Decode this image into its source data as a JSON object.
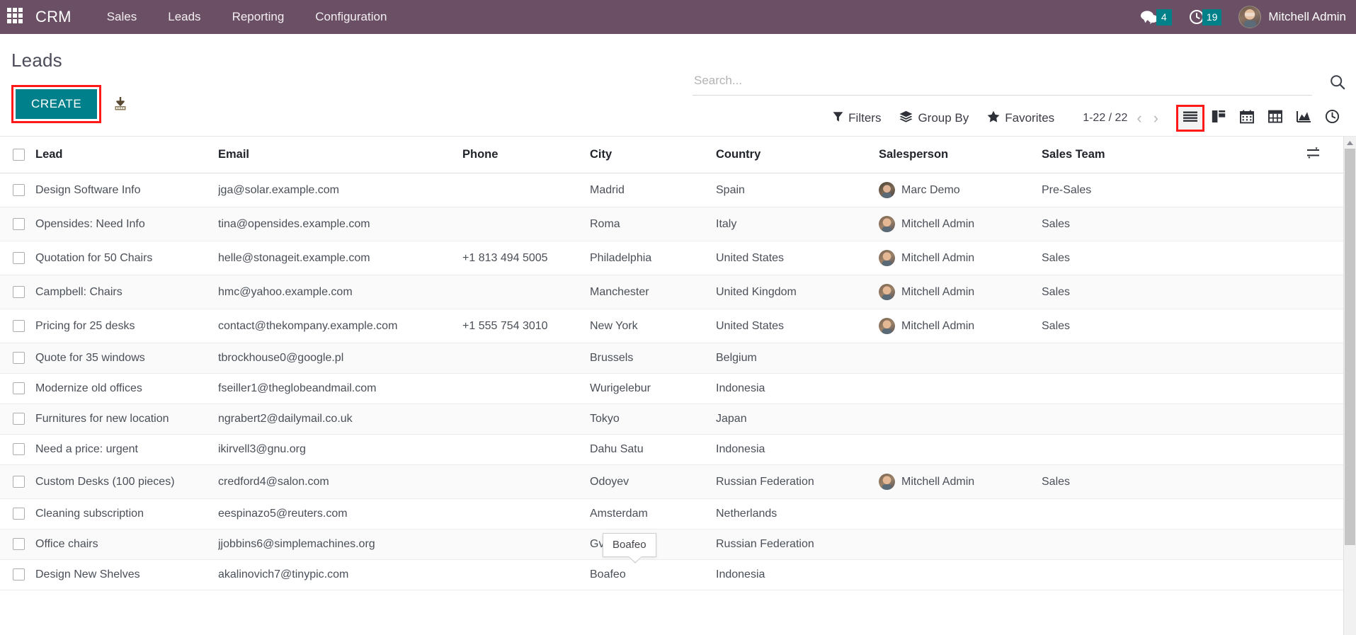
{
  "navbar": {
    "apps_icon": "apps-grid-icon",
    "brand": "CRM",
    "menu": [
      {
        "label": "Sales"
      },
      {
        "label": "Leads"
      },
      {
        "label": "Reporting"
      },
      {
        "label": "Configuration"
      }
    ],
    "messages": {
      "icon": "comments-icon",
      "count": "4"
    },
    "activities": {
      "icon": "clock-icon",
      "count": "19"
    },
    "user": {
      "name": "Mitchell Admin",
      "avatar": "user-avatar"
    }
  },
  "control_panel": {
    "title": "Leads",
    "create_label": "CREATE",
    "import_icon": "import-download-icon",
    "highlight_color": "#ff1a1a",
    "create_color": "#00808b",
    "search": {
      "placeholder": "Search...",
      "value": ""
    },
    "search_icon": "search-magnifier-icon",
    "dropdowns": [
      {
        "label": "Filters",
        "icon": "filter-funnel-icon"
      },
      {
        "label": "Group By",
        "icon": "layers-icon"
      },
      {
        "label": "Favorites",
        "icon": "star-icon"
      }
    ],
    "pager": {
      "count": "1-22 / 22",
      "prev": "‹",
      "next": "›"
    },
    "views": [
      {
        "name": "list-view",
        "icon": "list-icon",
        "active": true
      },
      {
        "name": "kanban-view",
        "icon": "kanban-icon",
        "active": false
      },
      {
        "name": "calendar-view",
        "icon": "calendar-icon",
        "active": false
      },
      {
        "name": "pivot-view",
        "icon": "pivot-table-icon",
        "active": false
      },
      {
        "name": "graph-view",
        "icon": "area-chart-icon",
        "active": false
      },
      {
        "name": "activity-view",
        "icon": "clock-icon",
        "active": false
      }
    ]
  },
  "table": {
    "select_all_checkbox": "",
    "options_icon": "column-options-icon",
    "headers": {
      "lead": "Lead",
      "email": "Email",
      "phone": "Phone",
      "city": "City",
      "country": "Country",
      "salesperson": "Salesperson",
      "sales_team": "Sales Team"
    },
    "rows": [
      {
        "lead": "Design Software Info",
        "email": "jga@solar.example.com",
        "phone": "",
        "city": "Madrid",
        "country": "Spain",
        "salesperson": "Marc Demo",
        "team": "Pre-Sales"
      },
      {
        "lead": "Opensides: Need Info",
        "email": "tina@opensides.example.com",
        "phone": "",
        "city": "Roma",
        "country": "Italy",
        "salesperson": "Mitchell Admin",
        "team": "Sales"
      },
      {
        "lead": "Quotation for 50 Chairs",
        "email": "helle@stonageit.example.com",
        "phone": "+1 813 494 5005",
        "city": "Philadelphia",
        "country": "United States",
        "salesperson": "Mitchell Admin",
        "team": "Sales"
      },
      {
        "lead": "Campbell: Chairs",
        "email": "hmc@yahoo.example.com",
        "phone": "",
        "city": "Manchester",
        "country": "United Kingdom",
        "salesperson": "Mitchell Admin",
        "team": "Sales"
      },
      {
        "lead": "Pricing for 25 desks",
        "email": "contact@thekompany.example.com",
        "phone": "+1 555 754 3010",
        "city": "New York",
        "country": "United States",
        "salesperson": "Mitchell Admin",
        "team": "Sales"
      },
      {
        "lead": "Quote for 35 windows",
        "email": "tbrockhouse0@google.pl",
        "phone": "",
        "city": "Brussels",
        "country": "Belgium",
        "salesperson": "",
        "team": ""
      },
      {
        "lead": "Modernize old offices",
        "email": "fseiller1@theglobeandmail.com",
        "phone": "",
        "city": "Wurigelebur",
        "country": "Indonesia",
        "salesperson": "",
        "team": ""
      },
      {
        "lead": "Furnitures for new location",
        "email": "ngrabert2@dailymail.co.uk",
        "phone": "",
        "city": "Tokyo",
        "country": "Japan",
        "salesperson": "",
        "team": ""
      },
      {
        "lead": "Need a price: urgent",
        "email": "ikirvell3@gnu.org",
        "phone": "",
        "city": "Dahu Satu",
        "country": "Indonesia",
        "salesperson": "",
        "team": ""
      },
      {
        "lead": "Custom Desks (100 pieces)",
        "email": "credford4@salon.com",
        "phone": "",
        "city": "Odoyev",
        "country": "Russian Federation",
        "salesperson": "Mitchell Admin",
        "team": "Sales"
      },
      {
        "lead": "Cleaning subscription",
        "email": "eespinazo5@reuters.com",
        "phone": "",
        "city": "Amsterdam",
        "country": "Netherlands",
        "salesperson": "",
        "team": ""
      },
      {
        "lead": "Office chairs",
        "email": "jjobbins6@simplemachines.org",
        "phone": "",
        "city": "Gvardeysk",
        "country": "Russian Federation",
        "salesperson": "",
        "team": ""
      },
      {
        "lead": "Design New Shelves",
        "email": "akalinovich7@tinypic.com",
        "phone": "",
        "city": "Boafeo",
        "country": "Indonesia",
        "salesperson": "",
        "team": ""
      }
    ]
  },
  "tooltip": {
    "text": "Boafeo"
  }
}
